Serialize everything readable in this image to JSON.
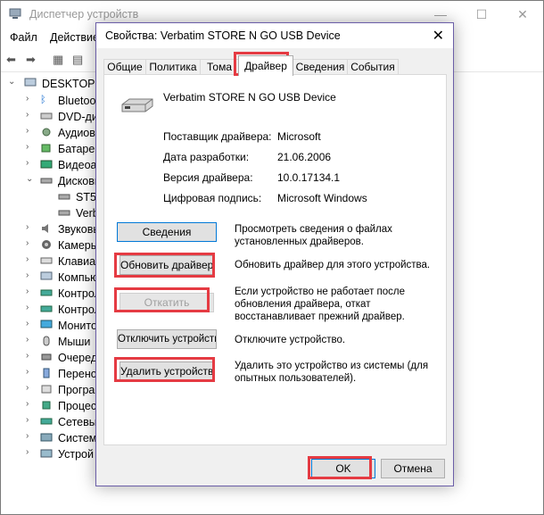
{
  "main_window": {
    "title": "Диспетчер устройств",
    "minimize": "—",
    "maximize": "☐",
    "close": "✕",
    "menu": [
      "Файл",
      "Действие"
    ],
    "tree": {
      "root": "DESKTOP-5",
      "items": [
        "Bluetoot",
        "DVD-дис",
        "Аудиов",
        "Батареи",
        "Видеоа",
        "Дисковы",
        "ST50",
        "Verb",
        "Звуковы",
        "Камеры",
        "Клавиат",
        "Компью",
        "Контрол",
        "Контрол",
        "Монито",
        "Мыши",
        "Очеред",
        "Перено",
        "Програ",
        "Процес",
        "Сетевы",
        "Систем",
        "Устрой"
      ]
    }
  },
  "dialog": {
    "title": "Свойства: Verbatim STORE N GO USB Device",
    "close": "✕",
    "tabs": [
      "Общие",
      "Политика",
      "Тома",
      "Драйвер",
      "Сведения",
      "События"
    ],
    "device_name": "Verbatim STORE N GO USB Device",
    "properties": [
      {
        "label": "Поставщик драйвера:",
        "value": "Microsoft"
      },
      {
        "label": "Дата разработки:",
        "value": "21.06.2006"
      },
      {
        "label": "Версия драйвера:",
        "value": "10.0.17134.1"
      },
      {
        "label": "Цифровая подпись:",
        "value": "Microsoft Windows"
      }
    ],
    "actions": [
      {
        "button": "Сведения",
        "description": "Просмотреть сведения о файлах установленных драйверов."
      },
      {
        "button": "Обновить драйвер",
        "description": "Обновить драйвер для этого устройства."
      },
      {
        "button": "Откатить",
        "description": "Если устройство не работает после обновления драйвера, откат восстанавливает прежний драйвер."
      },
      {
        "button": "Отключить устройство",
        "description": "Отключите устройство."
      },
      {
        "button": "Удалить устройство",
        "description": "Удалить это устройство из системы (для опытных пользователей)."
      }
    ],
    "ok": "OK",
    "cancel": "Отмена"
  },
  "colors": {
    "highlight": "#e53b43",
    "dialog_border": "#6b5ea8",
    "focus": "#0078d7"
  }
}
